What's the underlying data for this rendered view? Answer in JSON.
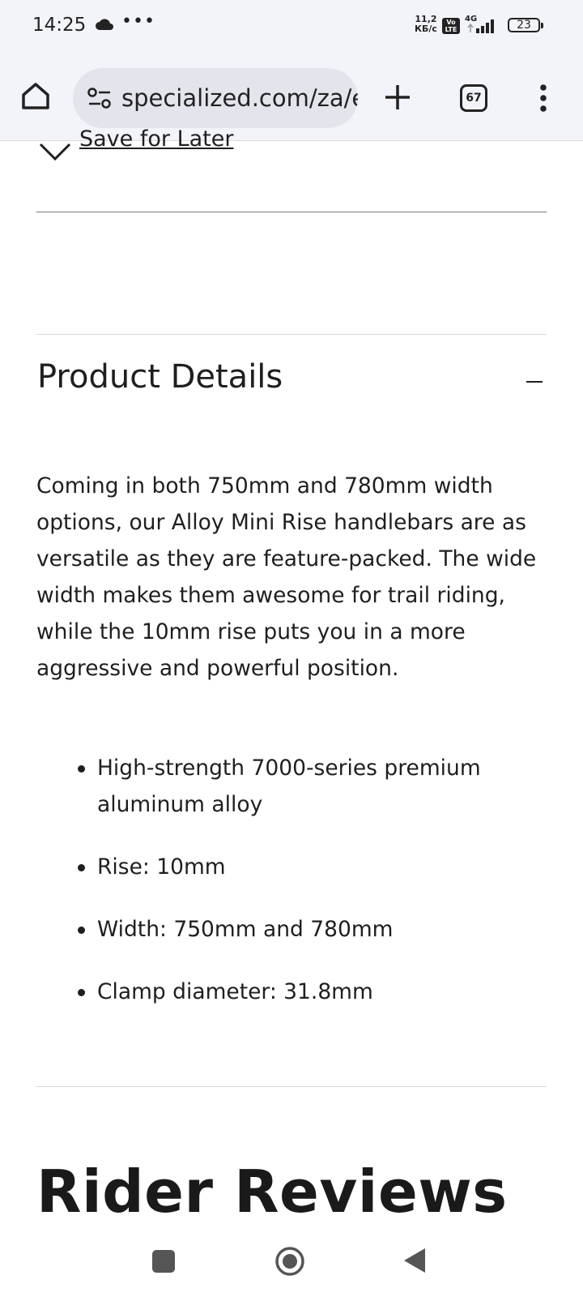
{
  "status_bar": {
    "time": "14:25",
    "notif_icon": "cloud-icon",
    "overflow": "•••",
    "speed_value": "11,2",
    "speed_unit": "КБ/с",
    "volte_top": "Vo",
    "volte_bottom": "LTE",
    "network": "4G",
    "battery": "23"
  },
  "browser": {
    "url": "specialized.com/za/e",
    "tab_count": "67"
  },
  "page": {
    "save_for_later": "Save for Later",
    "product_details": {
      "title": "Product Details",
      "description": "Coming in both 750mm and 780mm width options, our Alloy Mini Rise handlebars are as versatile as they are feature-packed. The wide width makes them awesome for trail riding, while the 10mm rise puts you in a more aggressive and powerful position.",
      "features": [
        "High-strength 7000-series premium aluminum alloy",
        "Rise: 10mm",
        "Width: 750mm and 780mm",
        "Clamp diameter: 31.8mm"
      ]
    },
    "reviews_title": "Rider Reviews"
  },
  "colors": {
    "chrome_bg": "#f3f4fa",
    "url_bg": "#e3e4ec",
    "text": "#1f1f1f"
  }
}
